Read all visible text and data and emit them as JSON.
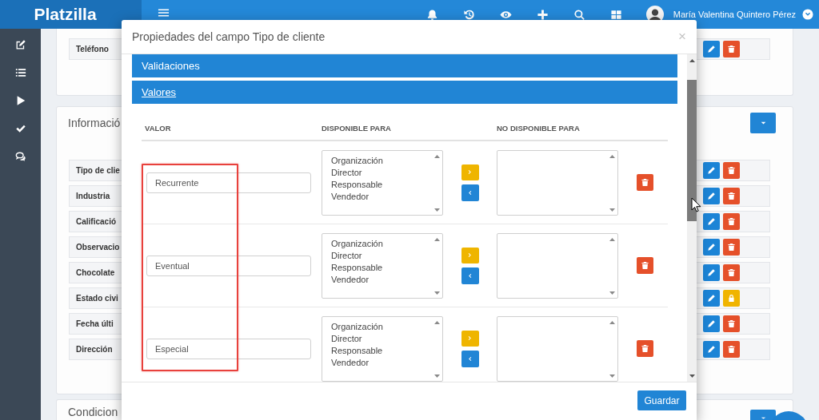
{
  "topbar": {
    "logo": "Platzilla",
    "icons": [
      {
        "kind": "bell"
      },
      {
        "kind": "history"
      },
      {
        "kind": "eye"
      },
      {
        "kind": "plus"
      },
      {
        "kind": "search"
      },
      {
        "kind": "grid"
      }
    ],
    "user_name": "María Valentina Quintero Pérez"
  },
  "sidebar": {
    "items": [
      {
        "kind": "edit"
      },
      {
        "kind": "list"
      },
      {
        "kind": "play"
      },
      {
        "kind": "check"
      },
      {
        "kind": "comments"
      }
    ]
  },
  "cards": [
    {
      "rows": [
        {
          "label": "Teléfono",
          "locked": false
        }
      ]
    },
    {
      "title": "Informació",
      "rows": [
        {
          "label": "Tipo de clie",
          "locked": false
        },
        {
          "label": "Industria",
          "locked": false
        },
        {
          "label": "Calificació",
          "locked": false
        },
        {
          "label": "Observacio",
          "locked": false
        },
        {
          "label": "Chocolate",
          "locked": false
        },
        {
          "label": "Estado civi",
          "locked": true
        },
        {
          "label": "Fecha últi",
          "locked": false
        },
        {
          "label": "Dirección",
          "locked": false
        }
      ]
    },
    {
      "title": "Condicion"
    }
  ],
  "modal": {
    "title": "Propiedades del campo Tipo de cliente",
    "close": "×",
    "sections": [
      {
        "label": "Validaciones",
        "expanded": false
      },
      {
        "label": "Valores",
        "expanded": true
      }
    ],
    "columns": [
      "VALOR",
      "DISPONIBLE PARA",
      "NO DISPONIBLE PARA"
    ],
    "values_highlighted": true,
    "values": [
      {
        "value": "Recurrente",
        "available": [
          "Organización",
          "Director",
          "Responsable",
          "Vendedor"
        ]
      },
      {
        "value": "Eventual",
        "available": [
          "Organización",
          "Director",
          "Responsable",
          "Vendedor"
        ]
      },
      {
        "value": "Especial",
        "available": [
          "Organización",
          "Director",
          "Responsable",
          "Vendedor"
        ]
      }
    ],
    "save_button": "Guardar"
  }
}
